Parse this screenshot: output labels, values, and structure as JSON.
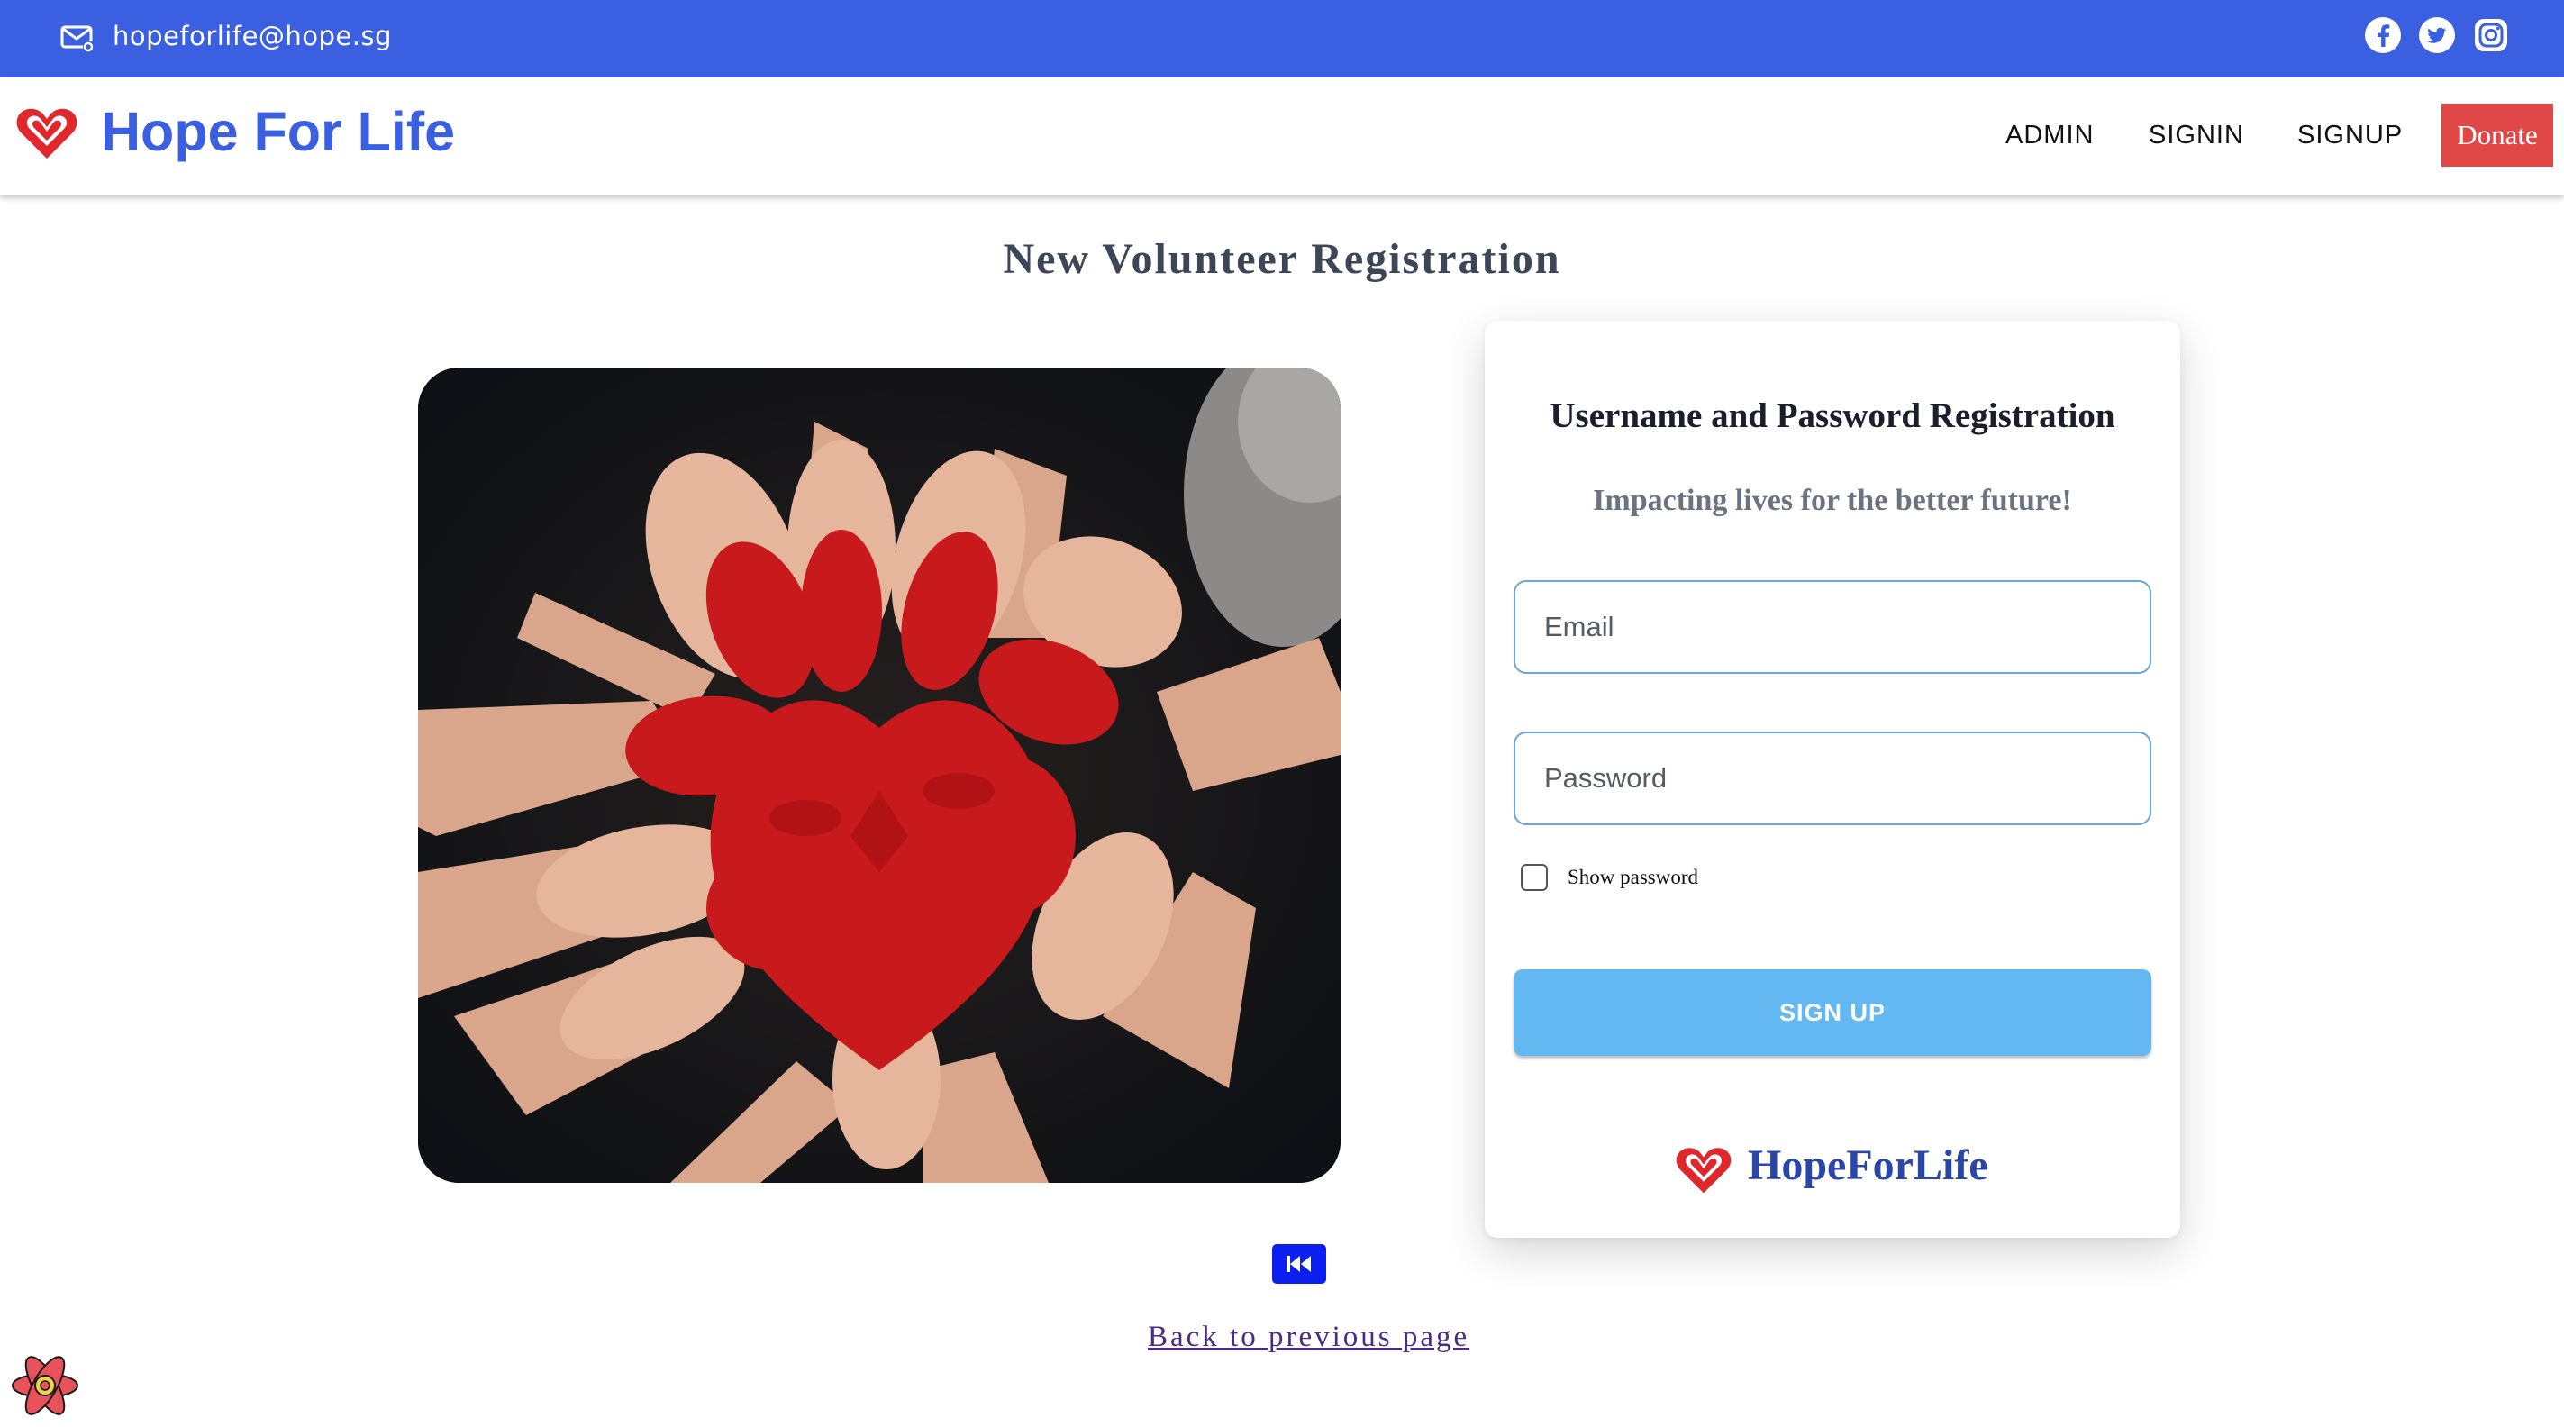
{
  "topbar": {
    "email": "hopeforlife@hope.sg",
    "icons": [
      "mail-icon",
      "facebook-icon",
      "twitter-icon",
      "instagram-icon"
    ],
    "color": "#3a5fe0"
  },
  "header": {
    "brand": "Hope For Life",
    "nav": {
      "admin": "ADMIN",
      "signin": "SIGNIN",
      "signup": "SIGNUP",
      "donate": "Donate"
    },
    "brand_color": "#3a5fe0",
    "donate_color": "#e04848"
  },
  "page": {
    "title": "New Volunteer Registration",
    "image": "painted-red-hands-heart-photo"
  },
  "form": {
    "title": "Username and Password Registration",
    "subtitle": "Impacting lives for the better future!",
    "email_placeholder": "Email",
    "password_placeholder": "Password",
    "show_password": "Show password",
    "show_password_checked": false,
    "submit": "SIGN UP",
    "footer_brand": "HopeForLife",
    "button_color": "#63b8f2"
  },
  "back": {
    "icon": "rewind-icon",
    "link": "Back to previous page"
  },
  "devtools": {
    "icon": "react-icon"
  }
}
